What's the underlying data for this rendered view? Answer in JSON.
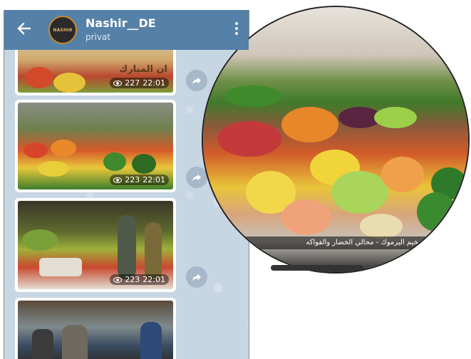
{
  "header": {
    "title": "Nashir__DE",
    "subtitle": "privat",
    "avatar_text": "NASHIR"
  },
  "messages": [
    {
      "views": "227",
      "time": "22:01",
      "overlay_text": "ان المبارك"
    },
    {
      "views": "223",
      "time": "22:01"
    },
    {
      "views": "223",
      "time": "22:01"
    },
    {
      "views": "",
      "time": ""
    }
  ],
  "zoom": {
    "caption": "ة في مخيم اليرموك - محالي الخضار والفواكه"
  },
  "colors": {
    "header_bg": "#5580a8",
    "chat_bg": "#c7d6e3",
    "share_button": "#a6b8c9"
  },
  "icons": {
    "back": "arrow-left-icon",
    "menu": "more-vertical-icon",
    "views": "eye-icon",
    "share": "share-arrow-icon"
  }
}
